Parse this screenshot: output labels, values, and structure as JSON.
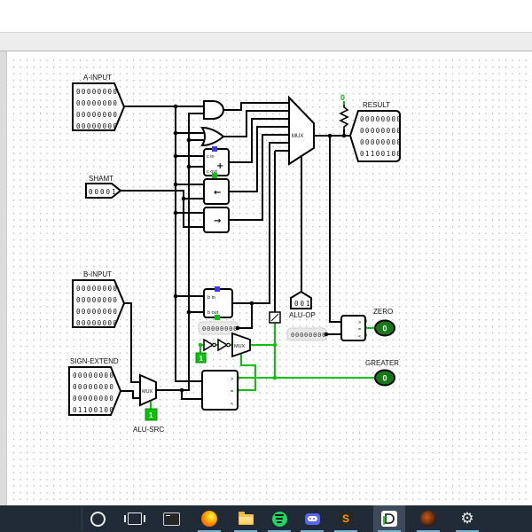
{
  "circuit": {
    "pins": {
      "a_input": {
        "label": "A-INPUT",
        "rows": [
          "00000000",
          "00000000",
          "00000000",
          "00000000"
        ]
      },
      "shamt": {
        "label": "SHAMT",
        "value": "00001"
      },
      "b_input": {
        "label": "B-INPUT",
        "rows": [
          "00000000",
          "00000000",
          "00000000",
          "00000000"
        ]
      },
      "sign_extend": {
        "label": "SIGN-EXTEND",
        "rows": [
          "00000000",
          "00000000",
          "00000000",
          "01100100"
        ]
      },
      "result": {
        "label": "RESULT",
        "rows": [
          "00000000",
          "00000000",
          "00000000",
          "01100100"
        ]
      },
      "alu_op": {
        "label": "ALU-OP",
        "value": "001"
      },
      "alu_src": {
        "label": "ALU-SRC",
        "const_value": "1"
      },
      "zero": {
        "label": "ZERO",
        "value": "0"
      },
      "greater": {
        "label": "GREATER",
        "value": "0"
      }
    },
    "components": {
      "adder": {
        "top_label": "c in",
        "symbol": "+",
        "bottom_label": "c out"
      },
      "subtractor": {
        "top_label": "b in",
        "bottom_label": "b out"
      },
      "shift_left_symbol": "←",
      "shift_right_symbol": "→",
      "mux_label": "MUX",
      "pull_resistor_value": "0",
      "slt_const": "1",
      "probe_upper": "00000000",
      "probe_lower": "00000000",
      "comparator_gt": ">",
      "comparator_eq": "=",
      "comparator_lt": "<"
    },
    "colors": {
      "wire_active": "#0bc20b",
      "led_fill": "#157a15",
      "floating_pin": "#3a3aff"
    }
  },
  "taskbar": {
    "items": [
      {
        "name": "search"
      },
      {
        "name": "task-view"
      },
      {
        "name": "terminal"
      },
      {
        "name": "firefox"
      },
      {
        "name": "file-explorer"
      },
      {
        "name": "spotify"
      },
      {
        "name": "discord"
      },
      {
        "name": "sublime-text"
      },
      {
        "name": "logisim",
        "active": true
      },
      {
        "name": "planet"
      },
      {
        "name": "settings"
      }
    ],
    "sublime_letter": "S",
    "settings_glyph": "⚙"
  }
}
